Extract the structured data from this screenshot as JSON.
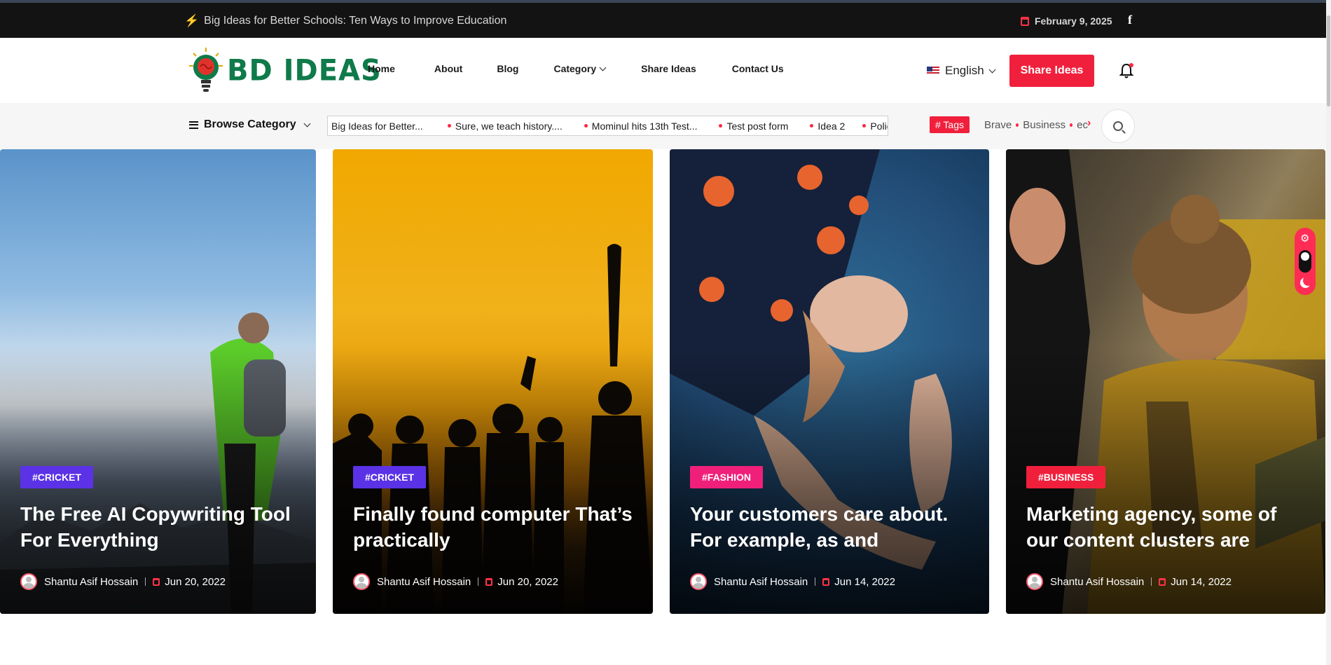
{
  "topbar": {
    "headline": "Big Ideas for Better Schools: Ten Ways to Improve Education",
    "date": "February 9, 2025"
  },
  "header": {
    "logo_text": "BD IDEAS",
    "nav": [
      "Home",
      "About",
      "Blog",
      "Category",
      "Share Ideas",
      "Contact Us"
    ],
    "language": "English",
    "share_button": "Share Ideas"
  },
  "catbar": {
    "browse_label": "Browse Category",
    "ticker": [
      "Big Ideas for Better...",
      "Sure, we teach history....",
      "Mominul hits 13th Test...",
      "Test post form",
      "Idea 2",
      "Polic"
    ],
    "tags_label": "# Tags",
    "tags": [
      "Brave",
      "Business",
      "ec"
    ]
  },
  "cards": [
    {
      "category": "#CRICKET",
      "category_color": "#5b32e6",
      "title": "The Free AI Copywriting Tool For Everything",
      "author": "Shantu Asif Hossain",
      "date": "Jun 20, 2022"
    },
    {
      "category": "#CRICKET",
      "category_color": "#5b32e6",
      "title": "Finally found computer That’s practically",
      "author": "Shantu Asif Hossain",
      "date": "Jun 20, 2022"
    },
    {
      "category": "#FASHION",
      "category_color": "#f0207a",
      "title": "Your customers care about. For example, as and",
      "author": "Shantu Asif Hossain",
      "date": "Jun 14, 2022"
    },
    {
      "category": "#BUSINESS",
      "category_color": "#f0203c",
      "title": "Marketing agency, some of our content clusters are",
      "author": "Shantu Asif Hossain",
      "date": "Jun 14, 2022"
    }
  ],
  "colors": {
    "accent": "#f0203c",
    "topbar": "#131313",
    "logo_green": "#0f7a4a"
  }
}
